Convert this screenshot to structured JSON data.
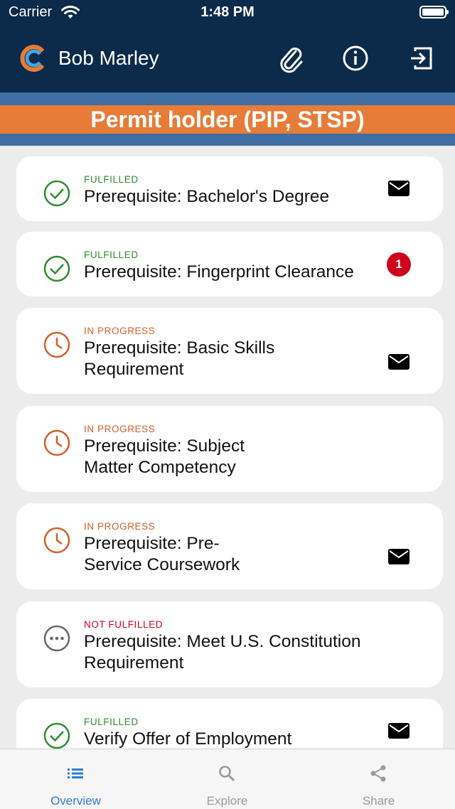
{
  "status_bar": {
    "carrier": "Carrier",
    "time": "1:48 PM"
  },
  "header": {
    "user_name": "Bob Marley",
    "icons": [
      "logo-icon",
      "paperclip-icon",
      "info-icon",
      "logout-icon"
    ]
  },
  "banner": {
    "title": "Permit holder (PIP, STSP)"
  },
  "colors": {
    "navy": "#0c2a4a",
    "blue_stripe": "#3e6ea3",
    "orange": "#e67c37",
    "fulfilled": "#2e8b2e",
    "in_progress": "#d35f2a",
    "not_fulfilled": "#d0021b",
    "tab_active": "#2e7bd6"
  },
  "requirements": [
    {
      "status": "FULFILLED",
      "label": "Prerequisite: Bachelor's Degree",
      "icon": "check-circle-icon",
      "action": "mail-icon"
    },
    {
      "status": "FULFILLED",
      "label": "Prerequisite: Fingerprint Clearance",
      "icon": "check-circle-icon",
      "badge": "1"
    },
    {
      "status": "IN PROGRESS",
      "label_lines": [
        "Prerequisite: Basic Skills",
        "Requirement"
      ],
      "icon": "clock-icon",
      "action": "mail-icon"
    },
    {
      "status": "IN PROGRESS",
      "label_lines": [
        "Prerequisite: Subject",
        "Matter Competency"
      ],
      "icon": "clock-icon"
    },
    {
      "status": "IN PROGRESS",
      "label_lines": [
        "Prerequisite: Pre-",
        "Service Coursework"
      ],
      "icon": "clock-icon",
      "action": "mail-icon"
    },
    {
      "status": "NOT FULFILLED",
      "label_lines": [
        "Prerequisite: Meet U.S. Constitution",
        "Requirement"
      ],
      "icon": "more-circle-icon"
    },
    {
      "status": "FULFILLED",
      "label": "Verify Offer of Employment",
      "icon": "check-circle-icon",
      "action": "mail-icon"
    }
  ],
  "tabs": [
    {
      "label": "Overview",
      "icon": "list-icon",
      "active": true
    },
    {
      "label": "Explore",
      "icon": "search-icon",
      "active": false
    },
    {
      "label": "Share",
      "icon": "share-icon",
      "active": false
    }
  ]
}
